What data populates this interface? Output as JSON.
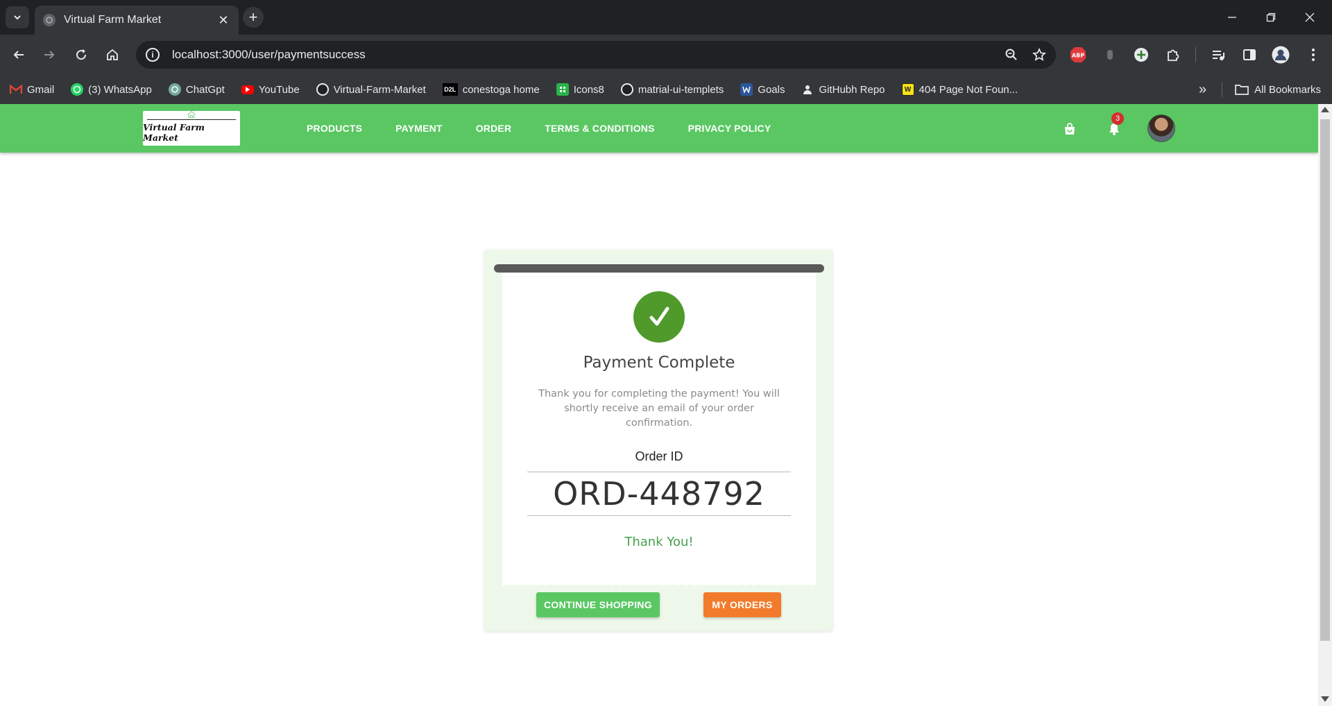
{
  "browser": {
    "tab_title": "Virtual Farm Market",
    "tab_close": "✕",
    "new_tab": "+",
    "url": "localhost:3000/user/paymentsuccess",
    "bookmarks": [
      {
        "label": "Gmail",
        "icon": "gmail-icon"
      },
      {
        "label": "(3) WhatsApp",
        "icon": "whatsapp-icon"
      },
      {
        "label": "ChatGpt",
        "icon": "chatgpt-icon"
      },
      {
        "label": "YouTube",
        "icon": "youtube-icon"
      },
      {
        "label": "Virtual-Farm-Market",
        "icon": "github-icon"
      },
      {
        "label": "conestoga home",
        "icon": "d2l-icon"
      },
      {
        "label": "Icons8",
        "icon": "icons8-icon"
      },
      {
        "label": "matrial-ui-templets",
        "icon": "github-icon"
      },
      {
        "label": "Goals",
        "icon": "word-icon"
      },
      {
        "label": "GitHubh Repo",
        "icon": "person-icon"
      },
      {
        "label": "404 Page Not Foun...",
        "icon": "w-icon"
      }
    ],
    "d2l_text": "D2L",
    "abp_text": "ABP",
    "w_text": "W",
    "all_bookmarks": "All Bookmarks",
    "more_bookmarks": "»"
  },
  "app": {
    "logo_text": "Virtual Farm Market",
    "nav": [
      "PRODUCTS",
      "PAYMENT",
      "ORDER",
      "TERMS & CONDITIONS",
      "PRIVACY POLICY"
    ],
    "notification_count": "3",
    "accent_color": "#5ac763"
  },
  "receipt": {
    "check_mark": "✓",
    "title": "Payment Complete",
    "message": "Thank you for completing the payment! You will shortly receive an email of your order confirmation.",
    "order_label": "Order ID",
    "order_id": "ORD-448792",
    "thanks": "Thank You!",
    "continue_label": "CONTINUE SHOPPING",
    "orders_label": "MY ORDERS",
    "success_color": "#4f9a2b",
    "orders_color": "#f27b2b"
  }
}
